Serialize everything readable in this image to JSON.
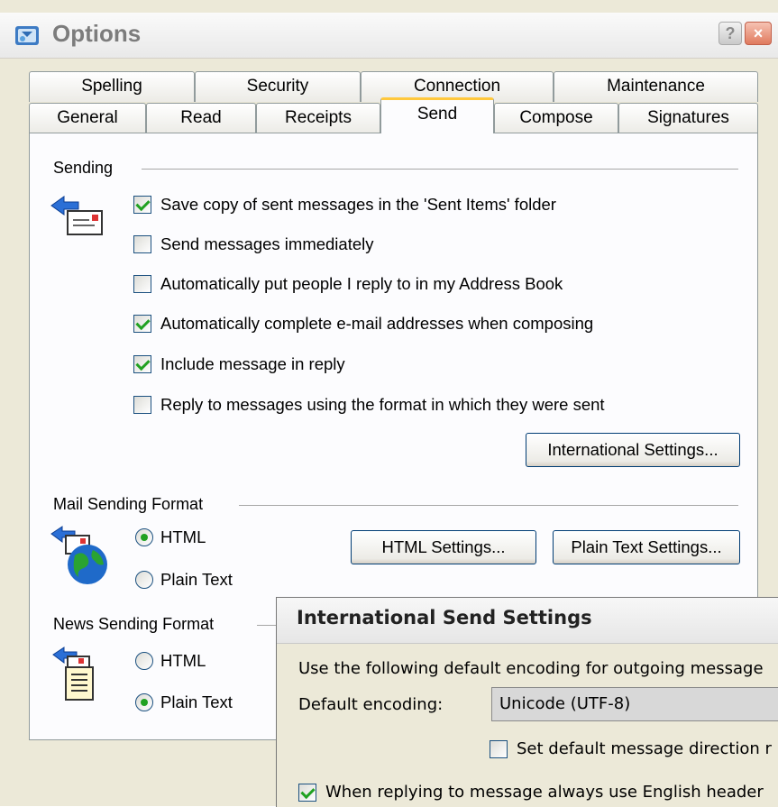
{
  "window": {
    "title": "Options",
    "help_glyph": "?",
    "close_glyph": "×"
  },
  "tabs_row1": [
    "Spelling",
    "Security",
    "Connection",
    "Maintenance"
  ],
  "tabs_row2": [
    "General",
    "Read",
    "Receipts",
    "Send",
    "Compose",
    "Signatures"
  ],
  "selected_tab": "Send",
  "sending": {
    "label": "Sending",
    "options": [
      {
        "label": "Save copy of sent messages in the 'Sent Items' folder",
        "checked": true
      },
      {
        "label": "Send messages immediately",
        "checked": false
      },
      {
        "label": "Automatically put people I reply to in my Address Book",
        "checked": false
      },
      {
        "label": "Automatically complete e-mail addresses when composing",
        "checked": true
      },
      {
        "label": "Include message in reply",
        "checked": true
      },
      {
        "label": "Reply to messages using the format in which they were sent",
        "checked": false
      }
    ],
    "intl_button": "International Settings..."
  },
  "mail_format": {
    "label": "Mail Sending Format",
    "html_label": "HTML",
    "plain_label": "Plain Text",
    "selected": "HTML",
    "html_settings": "HTML Settings...",
    "plain_settings": "Plain Text Settings..."
  },
  "news_format": {
    "label": "News Sending Format",
    "html_label": "HTML",
    "plain_label": "Plain Text",
    "selected": "Plain Text"
  },
  "intl_dialog": {
    "title": "International Send Settings",
    "intro": "Use the following default encoding for outgoing message",
    "encoding_label": "Default encoding:",
    "encoding_value": "Unicode (UTF-8)",
    "direction_label": "Set default message direction r",
    "direction_checked": false,
    "english_header_label": "When replying to message always use English header",
    "english_header_checked": true
  }
}
